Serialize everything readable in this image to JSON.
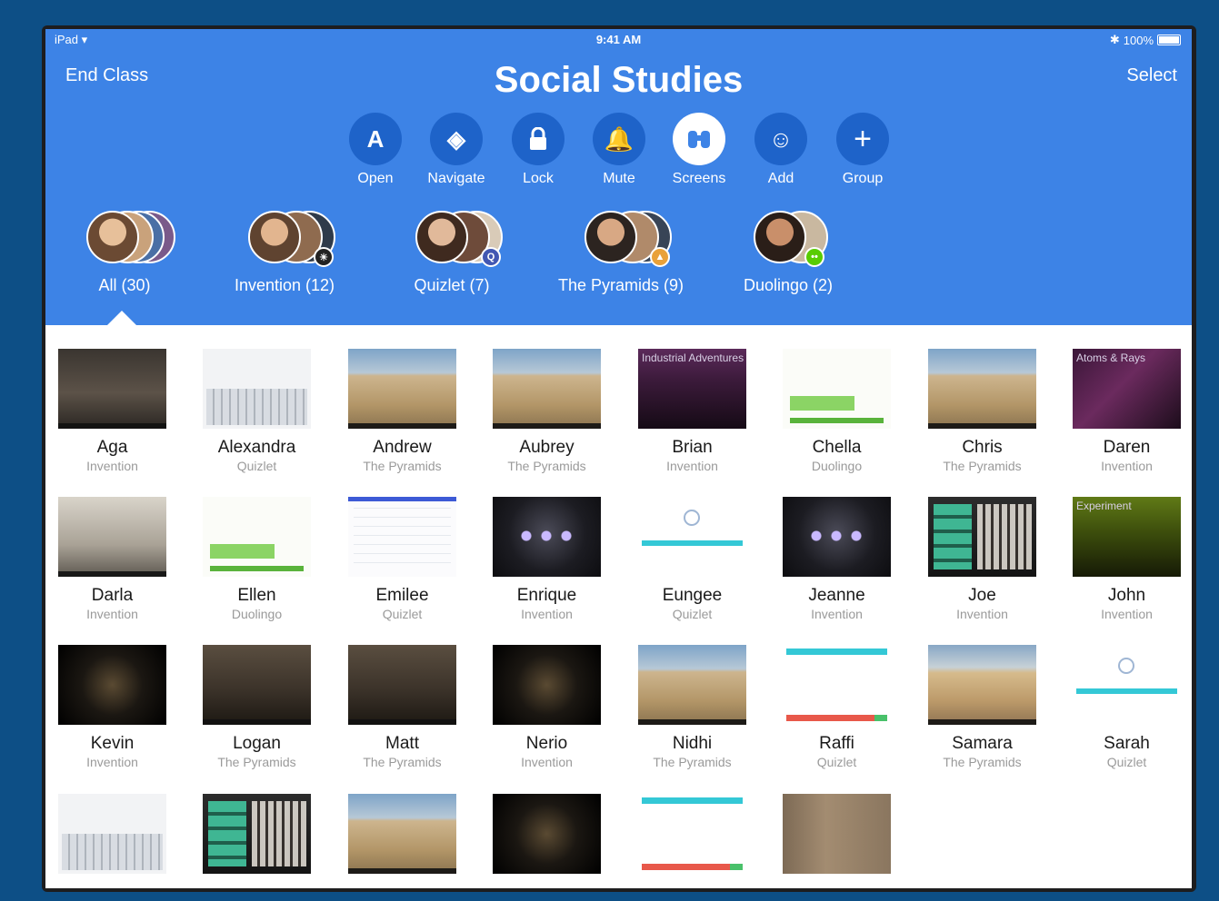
{
  "status_bar": {
    "device": "iPad",
    "time": "9:41 AM",
    "battery": "100%"
  },
  "nav": {
    "end_class": "End Class",
    "title": "Social Studies",
    "select": "Select"
  },
  "toolbar": [
    {
      "label": "Open",
      "icon": "app-store-icon"
    },
    {
      "label": "Navigate",
      "icon": "compass-icon"
    },
    {
      "label": "Lock",
      "icon": "lock-icon"
    },
    {
      "label": "Mute",
      "icon": "bell-slash-icon"
    },
    {
      "label": "Screens",
      "icon": "binoculars-icon",
      "active": true
    },
    {
      "label": "Add",
      "icon": "add-person-icon"
    },
    {
      "label": "Group",
      "icon": "plus-icon"
    }
  ],
  "groups": [
    {
      "label": "All (30)",
      "selected": true
    },
    {
      "label": "Invention (12)"
    },
    {
      "label": "Quizlet (7)"
    },
    {
      "label": "The Pyramids (9)"
    },
    {
      "label": "Duolingo (2)"
    }
  ],
  "students": [
    {
      "name": "Aga",
      "app": "Invention"
    },
    {
      "name": "Alexandra",
      "app": "Quizlet"
    },
    {
      "name": "Andrew",
      "app": "The Pyramids"
    },
    {
      "name": "Aubrey",
      "app": "The Pyramids"
    },
    {
      "name": "Brian",
      "app": "Invention",
      "thumb_text": "Industrial Adventures"
    },
    {
      "name": "Chella",
      "app": "Duolingo"
    },
    {
      "name": "Chris",
      "app": "The Pyramids"
    },
    {
      "name": "Daren",
      "app": "Invention",
      "thumb_text": "Atoms & Rays"
    },
    {
      "name": "Darla",
      "app": "Invention"
    },
    {
      "name": "Ellen",
      "app": "Duolingo"
    },
    {
      "name": "Emilee",
      "app": "Quizlet"
    },
    {
      "name": "Enrique",
      "app": "Invention"
    },
    {
      "name": "Eungee",
      "app": "Quizlet"
    },
    {
      "name": "Jeanne",
      "app": "Invention"
    },
    {
      "name": "Joe",
      "app": "Invention"
    },
    {
      "name": "John",
      "app": "Invention",
      "thumb_text": "Experiment"
    },
    {
      "name": "Kevin",
      "app": "Invention"
    },
    {
      "name": "Logan",
      "app": "The Pyramids"
    },
    {
      "name": "Matt",
      "app": "The Pyramids"
    },
    {
      "name": "Nerio",
      "app": "Invention"
    },
    {
      "name": "Nidhi",
      "app": "The Pyramids"
    },
    {
      "name": "Raffi",
      "app": "Quizlet"
    },
    {
      "name": "Samara",
      "app": "The Pyramids"
    },
    {
      "name": "Sarah",
      "app": "Quizlet"
    }
  ],
  "colors": {
    "header": "#3d83e6",
    "button": "#1e63c9",
    "frame": "#0d4f86"
  }
}
